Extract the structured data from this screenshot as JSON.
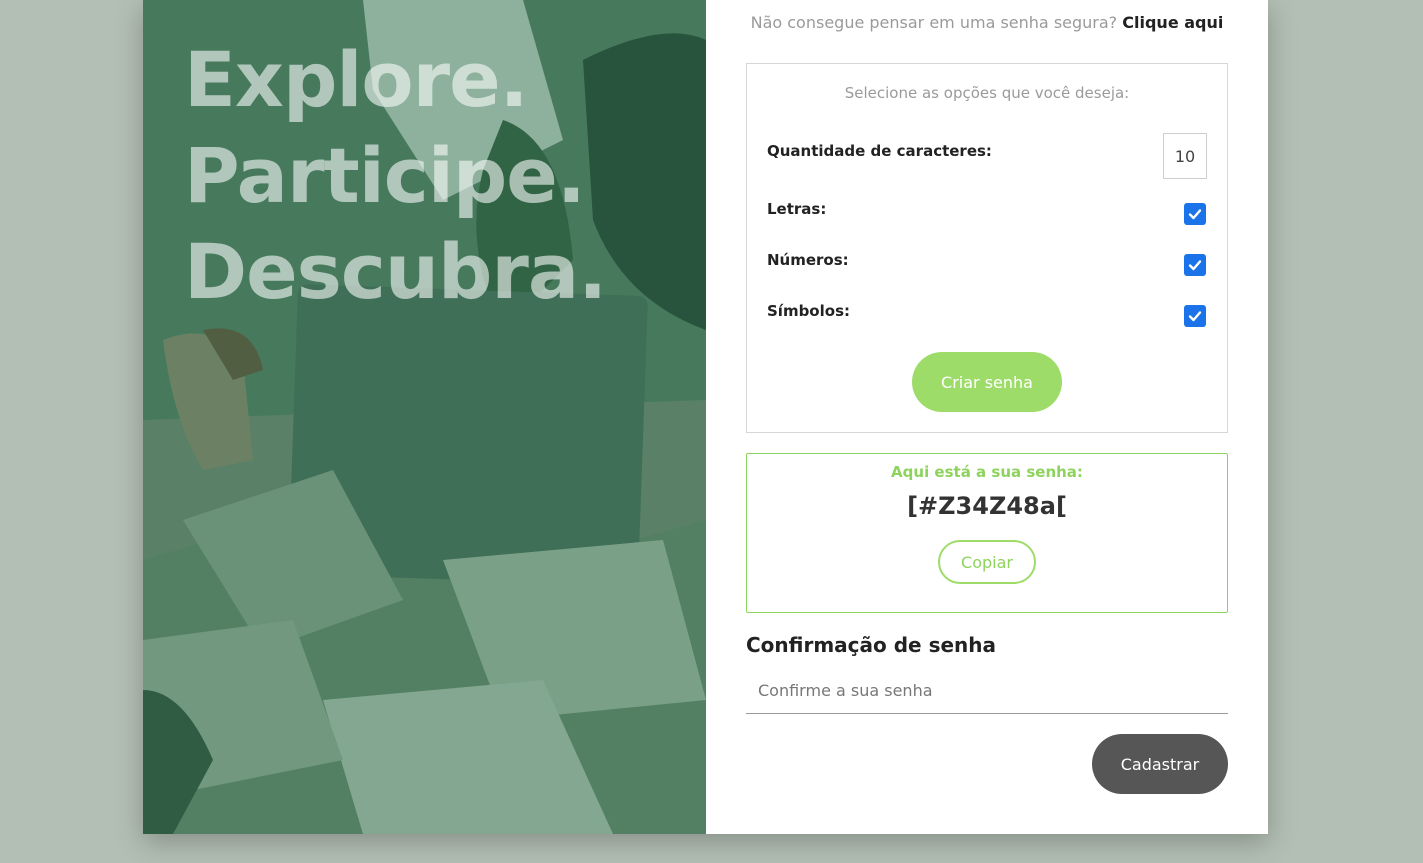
{
  "hero": {
    "slogan": [
      "Explore.",
      "Participe.",
      "Descubra."
    ]
  },
  "form": {
    "hint_text": "Não consegue pensar em uma senha segura?",
    "hint_link": "Clique aqui",
    "options": {
      "header": "Selecione as opções que você deseja:",
      "length_label": "Quantidade de caracteres:",
      "length_value": "10",
      "letters_label": "Letras:",
      "letters_checked": true,
      "numbers_label": "Números:",
      "numbers_checked": true,
      "symbols_label": "Símbolos:",
      "symbols_checked": true,
      "create_button": "Criar senha"
    },
    "result": {
      "title": "Aqui está a sua senha:",
      "password": "[#Z34Z48a[",
      "copy_button": "Copiar"
    },
    "confirm": {
      "title": "Confirmação de senha",
      "placeholder": "Confirme a sua senha",
      "submit_button": "Cadastrar"
    }
  },
  "colors": {
    "accent_green": "#9edc6a",
    "checkbox_blue": "#1a73e8",
    "submit_dark": "#565656",
    "page_bg": "#b3bfb4"
  }
}
